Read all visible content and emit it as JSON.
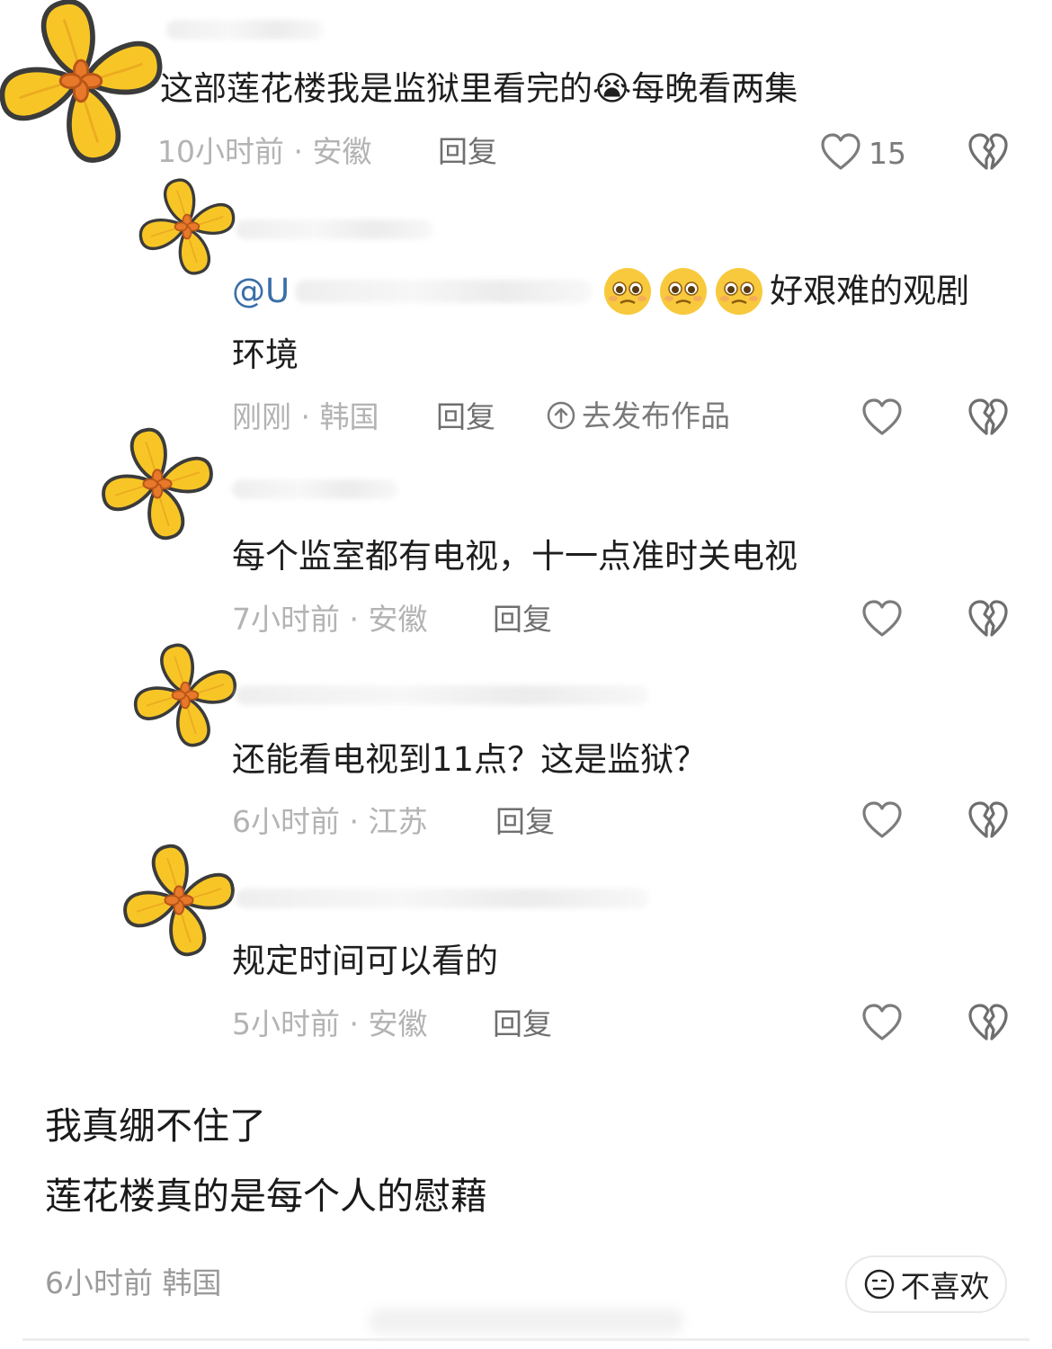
{
  "comment": {
    "text": "这部莲花楼我是监狱里看完的😭每晚看两集",
    "meta": "10小时前 · 安徽",
    "reply_label": "回复",
    "likes": "15"
  },
  "replies": [
    {
      "mention": "@U",
      "emoji": "face-holding-back-tears",
      "text_line1": "好艰难的观剧",
      "text_line2": "环境",
      "meta": "刚刚 · 韩国",
      "reply_label": "回复",
      "publish_label": "去发布作品"
    },
    {
      "text": "每个监室都有电视，十一点准时关电视",
      "meta": "7小时前 · 安徽",
      "reply_label": "回复"
    },
    {
      "text": "还能看电视到11点？这是监狱？",
      "meta": "6小时前 · 江苏",
      "reply_label": "回复"
    },
    {
      "text": "规定时间可以看的",
      "meta": "5小时前 · 安徽",
      "reply_label": "回复"
    }
  ],
  "post": {
    "caption_line1": "我真绷不住了",
    "caption_line2": "莲花楼真的是每个人的慰藉",
    "meta": "6小时前 韩国",
    "dislike_label": "不喜欢"
  },
  "colors": {
    "avatar_petal": "#f7c626",
    "avatar_outline": "#3b3b3b",
    "avatar_center": "#e8792a",
    "mention": "#3a6fa8"
  }
}
